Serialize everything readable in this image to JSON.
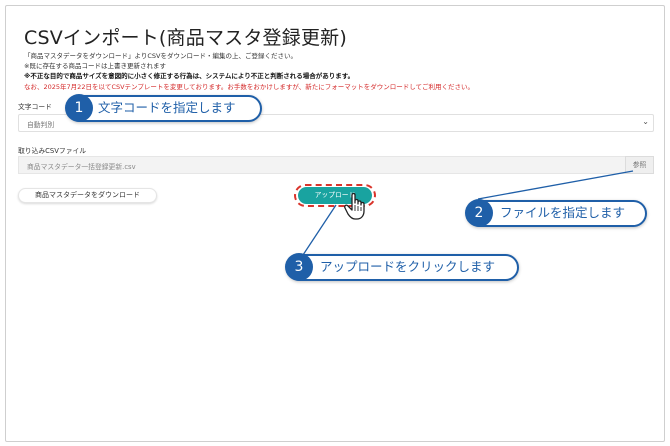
{
  "page": {
    "title": "CSVインポート(商品マスタ登録更新)",
    "notes": [
      "「商品マスタデータをダウンロード」よりCSVをダウンロード・編集の上、ご登録ください。",
      "※既に存在する商品コードは上書き更新されます",
      "※不正な目的で商品サイズを意図的に小さく修正する行為は、システムにより不正と判断される場合があります。",
      "なお、2025年7月22日を以てCSVテンプレートを変更しております。お手数をおかけしますが、新たにフォーマットをダウンロードしてご利用ください。"
    ]
  },
  "form": {
    "encoding_label": "文字コード",
    "encoding_value": "自動判別",
    "file_label": "取り込みCSVファイル",
    "file_value": "商品マスタデータ一括登録更新.csv",
    "browse_label": "参照",
    "download_label": "商品マスタデータをダウンロード",
    "upload_label": "アップロード"
  },
  "callouts": [
    {
      "num": "1",
      "text": "文字コードを指定します"
    },
    {
      "num": "2",
      "text": "ファイルを指定します"
    },
    {
      "num": "3",
      "text": "アップロードをクリックします"
    }
  ],
  "icons": {
    "select_arrow": "chevron-down-icon",
    "cursor": "hand-pointer-icon"
  },
  "colors": {
    "callout": "#1f5fa8",
    "upload_button": "#19a3a0",
    "highlight": "#d9342b",
    "warning_text": "#d42a2a"
  }
}
